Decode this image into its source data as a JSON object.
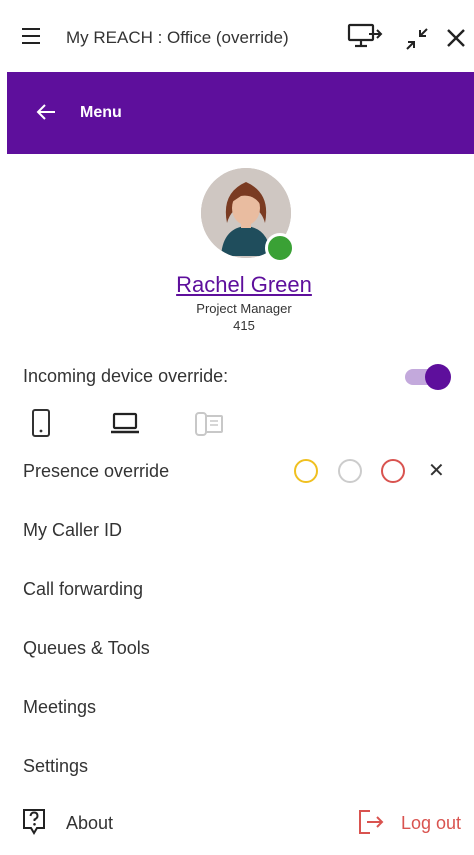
{
  "window": {
    "title": "My REACH : Office (override)"
  },
  "header": {
    "back_icon": "arrow-left-icon",
    "menu_label": "Menu",
    "accent": "#5e0f9c"
  },
  "user": {
    "name": "Rachel Green",
    "role": "Project Manager",
    "extension": "415",
    "status_color": "#3aa135"
  },
  "device_override": {
    "label": "Incoming device override:",
    "enabled": true,
    "devices": [
      "mobile-phone-icon",
      "laptop-icon",
      "desk-phone-icon"
    ],
    "selected": "laptop-icon"
  },
  "presence": {
    "label": "Presence override",
    "options": [
      {
        "name": "away",
        "color": "#f0c020"
      },
      {
        "name": "available",
        "color": "#cccccc"
      },
      {
        "name": "busy",
        "color": "#d9534f"
      }
    ],
    "clear_icon": "close-icon"
  },
  "menu": [
    {
      "label": "My Caller ID"
    },
    {
      "label": "Call forwarding"
    },
    {
      "label": "Queues & Tools"
    },
    {
      "label": "Meetings"
    },
    {
      "label": "Settings"
    }
  ],
  "footer": {
    "about_label": "About",
    "logout_label": "Log out",
    "logout_color": "#d9534f"
  }
}
